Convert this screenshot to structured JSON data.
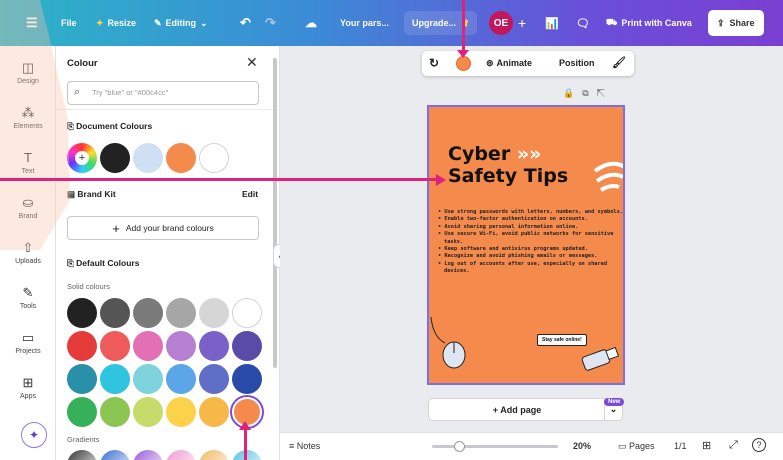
{
  "topbar": {
    "file": "File",
    "resize": "Resize",
    "editing": "Editing",
    "design_title": "Your pars...",
    "upgrade": "Upgrade...",
    "avatar_initials": "OE",
    "print": "Print with Canva",
    "share": "Share"
  },
  "rail": {
    "design": "Design",
    "elements": "Elements",
    "text": "Text",
    "brand": "Brand",
    "uploads": "Uploads",
    "tools": "Tools",
    "projects": "Projects",
    "apps": "Apps"
  },
  "panel": {
    "title": "Colour",
    "search_placeholder": "Try \"blue\" or \"#00c4cc\"",
    "document_colours": "Document Colours",
    "brand_kit": "Brand Kit",
    "edit": "Edit",
    "add_brand": "Add your brand colours",
    "default_colours": "Default Colours",
    "solid_colours": "Solid colours",
    "gradients": "Gradients",
    "document_swatches": [
      "#222222",
      "#cfe0f5",
      "#f48a4c",
      "#ffffff"
    ],
    "solid_swatches": [
      [
        "#222222",
        "#555555",
        "#7a7a7a",
        "#a6a6a6",
        "#d6d6d6",
        "#ffffff"
      ],
      [
        "#e63b3b",
        "#ef5a5a",
        "#e36fb4",
        "#b77fd0",
        "#7a61c9",
        "#5b4ba8"
      ],
      [
        "#2a8fa8",
        "#2fc4e0",
        "#7fd3dc",
        "#5aa6e6",
        "#5f6fc8",
        "#2a4aa8"
      ],
      [
        "#36b15a",
        "#8cc652",
        "#c6dc6a",
        "#fbd24a",
        "#f7b84a",
        "#f48a4c"
      ]
    ],
    "gradient_swatches": [
      "#333333",
      "#3a6fd0",
      "#9a5ad8",
      "#f09ad0",
      "#f0b860",
      "#55c0e0"
    ]
  },
  "toolbar": {
    "animate": "Animate",
    "position": "Position"
  },
  "poster": {
    "title_line1": "Cyber",
    "title_line2": "Safety Tips",
    "bullets": [
      "Use strong passwords with letters, numbers, and symbols.",
      "Enable two-factor authentication on accounts.",
      "Avoid sharing personal information online.",
      "Use secure Wi-Fi, avoid public networks for sensitive tasks.",
      "Keep software and antivirus programs updated.",
      "Recognize and avoid phishing emails or messages.",
      "Log out of accounts after use, especially on shared devices."
    ],
    "badge": "Stay safe online!"
  },
  "canvas": {
    "add_page": "+ Add page",
    "new_badge": "New"
  },
  "bottom": {
    "notes": "Notes",
    "zoom": "20%",
    "pages": "Pages",
    "page_count": "1/1"
  },
  "colors": {
    "accent_pink": "#e1227d",
    "selection_purple": "#7b6ee6",
    "poster_orange": "#f48a4c"
  }
}
